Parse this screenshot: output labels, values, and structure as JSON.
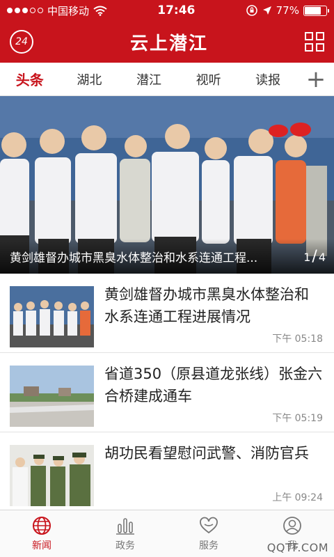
{
  "status_bar": {
    "carrier": "中国移动",
    "time": "17:46",
    "battery": "77%",
    "battery_level": 0.77
  },
  "header": {
    "badge": "24",
    "title": "云上潜江",
    "left_icon": "24h-icon",
    "right_icon": "grid-icon"
  },
  "tabs": [
    {
      "label": "头条",
      "active": true
    },
    {
      "label": "湖北"
    },
    {
      "label": "潜江"
    },
    {
      "label": "视听"
    },
    {
      "label": "读报"
    }
  ],
  "add_tab": "+",
  "hero": {
    "title": "黄剑雄督办城市黑臭水体整治和水系连通工程...",
    "page_current": "1",
    "page_total": "4"
  },
  "news": [
    {
      "title": "黄剑雄督办城市黑臭水体整治和水系连通工程进展情况",
      "time": "下午 05:18"
    },
    {
      "title": "省道350（原县道龙张线）张金六合桥建成通车",
      "time": "下午 05:19"
    },
    {
      "title": "胡功民看望慰问武警、消防官兵",
      "time": "上午 09:24"
    }
  ],
  "bottom_nav": [
    {
      "label": "新闻",
      "icon": "globe-icon",
      "active": true
    },
    {
      "label": "政务",
      "icon": "bar-chart-icon"
    },
    {
      "label": "服务",
      "icon": "heart-icon"
    },
    {
      "label": "我",
      "icon": "user-icon"
    }
  ],
  "watermark": "QQTF.COM",
  "colors": {
    "accent": "#c8141c"
  }
}
